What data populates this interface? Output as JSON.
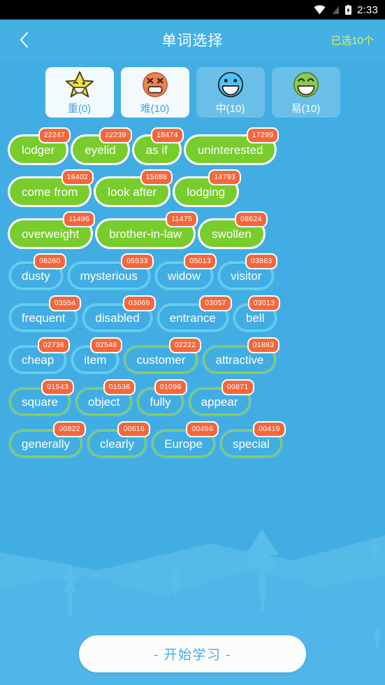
{
  "statusbar": {
    "time": "2:33",
    "icons": [
      "wifi-icon",
      "signal-off-icon",
      "battery-charging-icon"
    ]
  },
  "appbar": {
    "back_icon": "chevron-left-icon",
    "title": "单词选择",
    "selected_count": "已选10个",
    "accent_color": "#D7F56B",
    "bg_color": "#44B0E4"
  },
  "tabs": [
    {
      "label": "重(0)",
      "icon": "star-face-icon",
      "selected": true,
      "face_color": "#FAE03C"
    },
    {
      "label": "难(10)",
      "icon": "weary-face-icon",
      "selected": true,
      "face_color": "#EE8350"
    },
    {
      "label": "中(10)",
      "icon": "grinning-face-icon",
      "selected": false,
      "face_color": "#4FC3F7"
    },
    {
      "label": "易(10)",
      "icon": "smiling-face-icon",
      "selected": false,
      "face_color": "#8BCB50"
    }
  ],
  "word_rows": [
    [
      {
        "word": "lodger",
        "badge": "22247",
        "state": "selected"
      },
      {
        "word": "eyelid",
        "badge": "22239",
        "state": "selected"
      },
      {
        "word": "as if",
        "badge": "18474",
        "state": "selected"
      },
      {
        "word": "uninterested",
        "badge": "17299",
        "state": "selected"
      }
    ],
    [
      {
        "word": "come from",
        "badge": "16402",
        "state": "selected"
      },
      {
        "word": "look after",
        "badge": "15688",
        "state": "selected"
      },
      {
        "word": "lodging",
        "badge": "14793",
        "state": "selected"
      }
    ],
    [
      {
        "word": "overweight",
        "badge": "11496",
        "state": "selected"
      },
      {
        "word": "brother-in-law",
        "badge": "11475",
        "state": "selected"
      },
      {
        "word": "swollen",
        "badge": "08624",
        "state": "selected"
      }
    ],
    [
      {
        "word": "dusty",
        "badge": "08260",
        "state": "cyan"
      },
      {
        "word": "mysterious",
        "badge": "05533",
        "state": "cyan"
      },
      {
        "word": "widow",
        "badge": "05013",
        "state": "cyan"
      },
      {
        "word": "visitor",
        "badge": "03863",
        "state": "cyan"
      }
    ],
    [
      {
        "word": "frequent",
        "badge": "03554",
        "state": "cyan"
      },
      {
        "word": "disabled",
        "badge": "03069",
        "state": "cyan"
      },
      {
        "word": "entrance",
        "badge": "03057",
        "state": "cyan"
      },
      {
        "word": "bell",
        "badge": "03013",
        "state": "cyan"
      }
    ],
    [
      {
        "word": "cheap",
        "badge": "02736",
        "state": "cyan"
      },
      {
        "word": "item",
        "badge": "02548",
        "state": "cyan"
      },
      {
        "word": "customer",
        "badge": "02222",
        "state": "green"
      },
      {
        "word": "attractive",
        "badge": "01883",
        "state": "green"
      }
    ],
    [
      {
        "word": "square",
        "badge": "01543",
        "state": "green"
      },
      {
        "word": "object",
        "badge": "01536",
        "state": "green"
      },
      {
        "word": "fully",
        "badge": "01096",
        "state": "green"
      },
      {
        "word": "appear",
        "badge": "00871",
        "state": "green"
      }
    ],
    [
      {
        "word": "generally",
        "badge": "00822",
        "state": "green"
      },
      {
        "word": "clearly",
        "badge": "00616",
        "state": "green"
      },
      {
        "word": "Europe",
        "badge": "00496",
        "state": "green"
      },
      {
        "word": "special",
        "badge": "00419",
        "state": "green"
      }
    ]
  ],
  "start_button": {
    "label": "- 开始学习 -",
    "text_color": "#45ABE0"
  },
  "colors": {
    "background": "#41ADE3",
    "chip_selected": "#78CC2C",
    "chip_cyan_border": "#5FD8F5",
    "chip_green_border": "#8DD14A",
    "badge": "#F4673B"
  }
}
